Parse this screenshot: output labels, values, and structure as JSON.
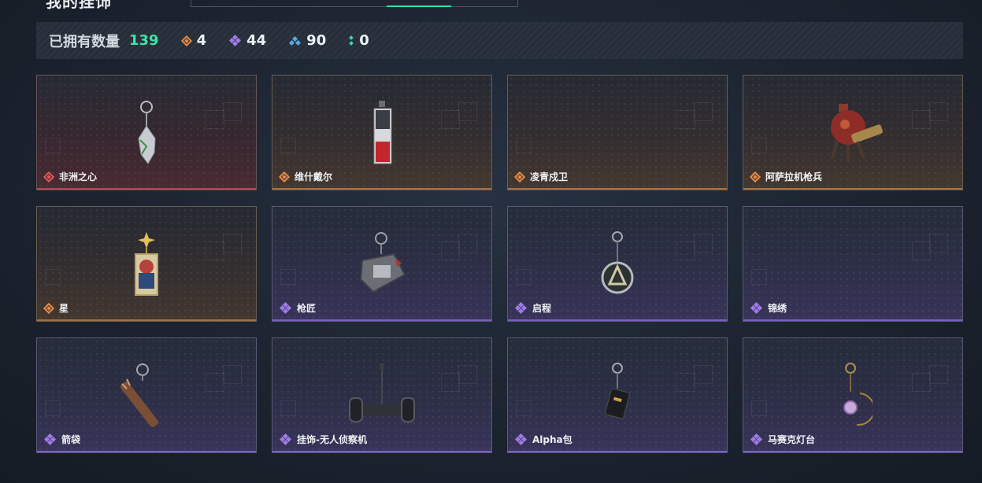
{
  "page": {
    "title_partial": "我的挂饰"
  },
  "stats": {
    "label": "已拥有数量",
    "total": "139",
    "counts": [
      {
        "icon": "orange-gem-icon",
        "value": "4"
      },
      {
        "icon": "purple-gem-icon",
        "value": "44"
      },
      {
        "icon": "blue-gem-icon",
        "value": "90"
      },
      {
        "icon": "green-gem-icon",
        "value": "0"
      }
    ]
  },
  "colors": {
    "accent_green": "#3de3a3",
    "orange": "#e58a45",
    "red": "#e0555a",
    "purple": "#a07ae8",
    "blue": "#5aa6e6",
    "green": "#3cd6a9"
  },
  "items": [
    {
      "name": "非洲之心",
      "rarity": "red",
      "icon": "heart-pendant-icon"
    },
    {
      "name": "维什戴尔",
      "rarity": "orange",
      "icon": "tag-pendant-icon"
    },
    {
      "name": "凌青戍卫",
      "rarity": "orange",
      "icon": ""
    },
    {
      "name": "阿萨拉机枪兵",
      "rarity": "orange",
      "icon": "robot-gunner-icon"
    },
    {
      "name": "星",
      "rarity": "orange",
      "icon": "card-pendant-icon"
    },
    {
      "name": "枪匠",
      "rarity": "purple",
      "icon": "toolbox-pendant-icon"
    },
    {
      "name": "启程",
      "rarity": "purple",
      "icon": "medal-pendant-icon"
    },
    {
      "name": "锦绣",
      "rarity": "purple",
      "icon": ""
    },
    {
      "name": "箭袋",
      "rarity": "purple",
      "icon": "quiver-pendant-icon"
    },
    {
      "name": "挂饰-无人侦察机",
      "rarity": "purple",
      "icon": "drone-pendant-icon"
    },
    {
      "name": "Alpha包",
      "rarity": "purple",
      "icon": "bag-pendant-icon"
    },
    {
      "name": "马赛克灯台",
      "rarity": "purple",
      "icon": "moon-lamp-pendant-icon"
    }
  ]
}
